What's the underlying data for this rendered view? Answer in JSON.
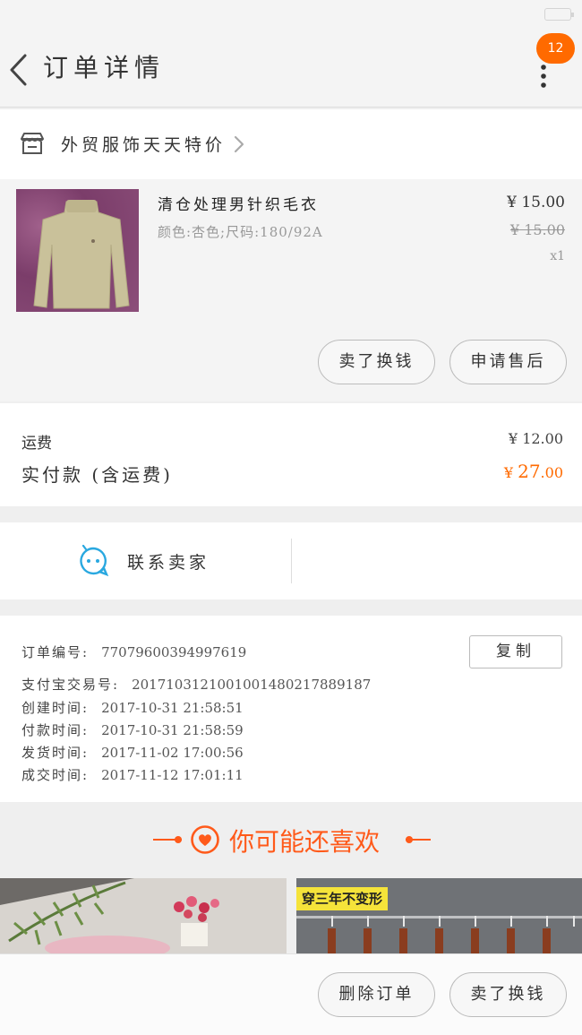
{
  "nav": {
    "title": "订单详情",
    "badge_count": "12"
  },
  "shop": {
    "name": "外贸服饰天天特价"
  },
  "item": {
    "title": "清仓处理男针织毛衣",
    "sku": "颜色:杏色;尺码:180/92A",
    "price": "¥ 15.00",
    "original_price": "¥ 15.00",
    "quantity": "x1",
    "btn_resell": "卖了换钱",
    "btn_aftersale": "申请售后"
  },
  "totals": {
    "shipping_label": "运费",
    "shipping_value": "¥ 12.00",
    "paid_label": "实付款 (含运费)",
    "paid_symbol": "¥ ",
    "paid_int": "27",
    "paid_dec": ".00"
  },
  "contact": {
    "label": "联系卖家"
  },
  "order": {
    "copy_label": "复制",
    "rows": [
      {
        "key": "订单编号:",
        "value": "77079600394997619"
      },
      {
        "key": "支付宝交易号:",
        "value": "2017103121001001480217889187"
      },
      {
        "key": "创建时间:",
        "value": "2017-10-31 21:58:51"
      },
      {
        "key": "付款时间:",
        "value": "2017-10-31 21:58:59"
      },
      {
        "key": "发货时间:",
        "value": "2017-11-02 17:00:56"
      },
      {
        "key": "成交时间:",
        "value": "2017-11-12 17:01:11"
      }
    ]
  },
  "recommend": {
    "title": "你可能还喜欢",
    "card2_tag": "穿三年不变形"
  },
  "bottom": {
    "btn_delete": "删除订单",
    "btn_resell": "卖了换钱"
  },
  "colors": {
    "accent": "#ff6a00",
    "recommend": "#ff5a1a"
  }
}
